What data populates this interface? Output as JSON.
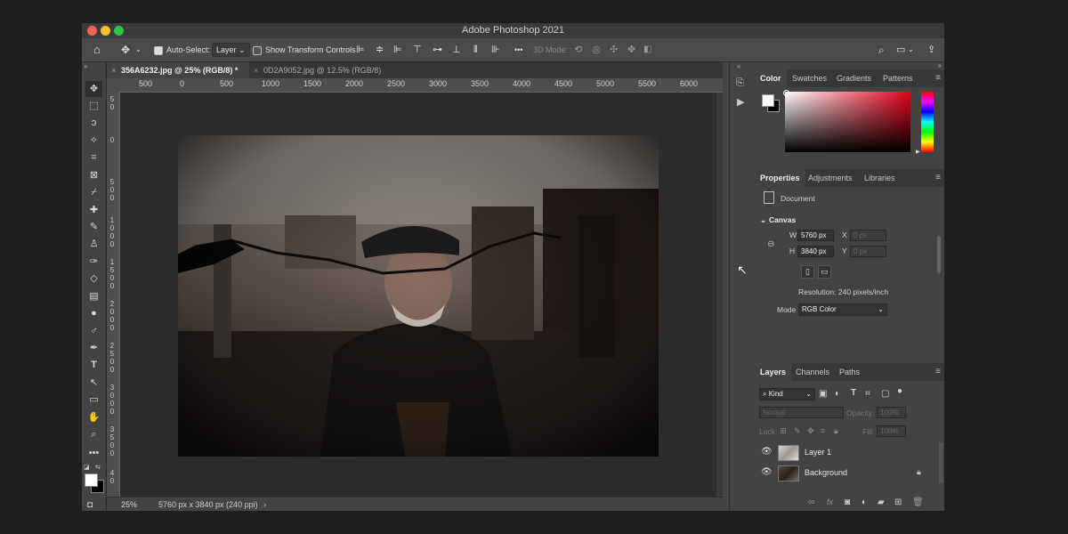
{
  "window": {
    "title": "Adobe Photoshop 2021"
  },
  "options_bar": {
    "auto_select_label": "Auto-Select:",
    "auto_select_value": "Layer",
    "show_transform_label": "Show Transform Controls",
    "mode_3d_label": "3D Mode:",
    "more_label": "•••"
  },
  "tabs": [
    {
      "label": "356A6232.jpg @ 25% (RGB/8) *",
      "active": true
    },
    {
      "label": "0D2A9052.jpg @ 12.5% (RGB/8)",
      "active": false
    }
  ],
  "ruler_top": [
    "500",
    "0",
    "500",
    "1000",
    "1500",
    "2000",
    "2500",
    "3000",
    "3500",
    "4000",
    "4500",
    "5000",
    "5500",
    "6000"
  ],
  "ruler_left": [
    "5\n0",
    "0",
    "5\n0\n0",
    "1\n0\n0\n0",
    "1\n5\n0\n0",
    "2\n0\n0\n0",
    "2\n5\n0\n0",
    "3\n0\n0\n0",
    "3\n5\n0\n0",
    "4\n0"
  ],
  "status": {
    "zoom": "25%",
    "doc_info": "5760 px x 3840 px (240 ppi)",
    "arrow": "›"
  },
  "color_panel": {
    "tabs": [
      "Color",
      "Swatches",
      "Gradients",
      "Patterns"
    ],
    "picker_hue": "#e4001b"
  },
  "properties_panel": {
    "tabs": [
      "Properties",
      "Adjustments",
      "Libraries"
    ],
    "doc_label": "Document",
    "section": "Canvas",
    "w_label": "W",
    "w_value": "5760 px",
    "h_label": "H",
    "h_value": "3840 px",
    "x_label": "X",
    "x_value": "0 px",
    "y_label": "Y",
    "y_value": "0 px",
    "resolution": "Resolution: 240 pixels/inch",
    "mode_label": "Mode",
    "mode_value": "RGB Color"
  },
  "layers_panel": {
    "tabs": [
      "Layers",
      "Channels",
      "Paths"
    ],
    "kind_label": "Kind",
    "blend_mode": "Normal",
    "opacity_label": "Opacity:",
    "opacity_value": "100%",
    "lock_label": "Lock:",
    "fill_label": "Fill:",
    "fill_value": "100%",
    "layers": [
      {
        "name": "Layer 1",
        "visible": true,
        "locked": false
      },
      {
        "name": "Background",
        "visible": true,
        "locked": true
      }
    ]
  },
  "colors": {
    "app_bg": "#434343",
    "canvas_bg": "#2b2b2b",
    "close": "#ff5f57",
    "minimize": "#febc2e",
    "maximize": "#28c840"
  }
}
